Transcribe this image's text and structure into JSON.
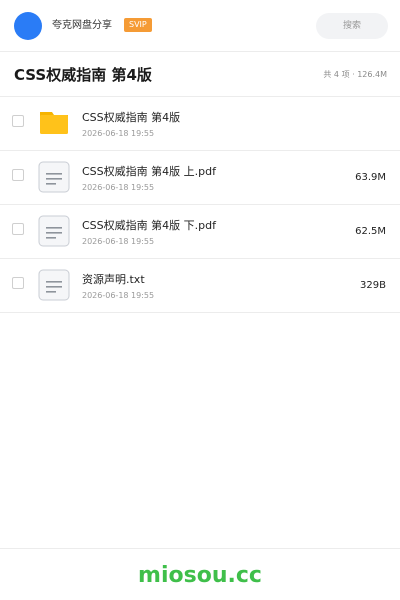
{
  "header": {
    "share_name": "夸克网盘分享",
    "badge": "SVIP",
    "search_placeholder": "搜索"
  },
  "folder": {
    "title": "CSS权威指南 第4版",
    "stats": "共 4 项 · 126.4M"
  },
  "files": [
    {
      "name": "CSS权威指南 第4版",
      "date": "2026-06-18 19:55",
      "size": "",
      "type": "folder-icon"
    },
    {
      "name": "CSS权威指南 第4版 上.pdf",
      "date": "2026-06-18 19:55",
      "size": "63.9M",
      "type": "document-icon"
    },
    {
      "name": "CSS权威指南 第4版 下.pdf",
      "date": "2026-06-18 19:55",
      "size": "62.5M",
      "type": "document-icon"
    },
    {
      "name": "资源声明.txt",
      "date": "2026-06-18 19:55",
      "size": "329B",
      "type": "document-icon"
    }
  ],
  "footer": {
    "brand": "miosou.cc"
  },
  "colors": {
    "accent": "#2a7cf6",
    "badge": "#f59b35",
    "folder": "#ffc21a",
    "brand": "#3fbf4a"
  }
}
